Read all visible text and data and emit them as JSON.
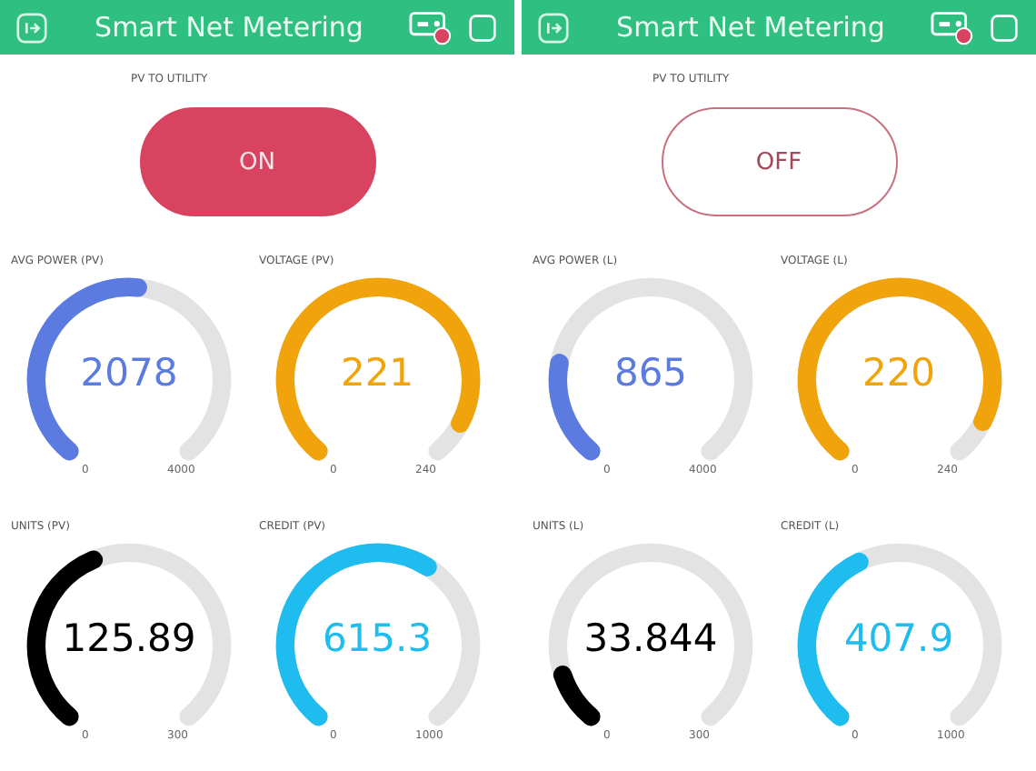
{
  "screens": [
    {
      "title": "Smart Net Metering",
      "toggle": {
        "label": "PV TO UTILITY",
        "text": "ON",
        "on": true
      },
      "gauges": [
        {
          "label": "AVG POWER (PV)",
          "value": "2078",
          "min": "0",
          "max": "4000",
          "color": "#5b7be0"
        },
        {
          "label": "VOLTAGE (PV)",
          "value": "221",
          "min": "0",
          "max": "240",
          "color": "#f0a30a"
        },
        {
          "label": "UNITS (PV)",
          "value": "125.89",
          "min": "0",
          "max": "300",
          "color": "#000000"
        },
        {
          "label": "CREDIT (PV)",
          "value": "615.3",
          "min": "0",
          "max": "1000",
          "color": "#1fbcef"
        }
      ]
    },
    {
      "title": "Smart Net Metering",
      "toggle": {
        "label": "PV TO UTILITY",
        "text": "OFF",
        "on": false
      },
      "gauges": [
        {
          "label": "AVG POWER (L)",
          "value": "865",
          "min": "0",
          "max": "4000",
          "color": "#5b7be0"
        },
        {
          "label": "VOLTAGE (L)",
          "value": "220",
          "min": "0",
          "max": "240",
          "color": "#f0a30a"
        },
        {
          "label": "UNITS (L)",
          "value": "33.844",
          "min": "0",
          "max": "300",
          "color": "#000000"
        },
        {
          "label": "CREDIT (L)",
          "value": "407.9",
          "min": "0",
          "max": "1000",
          "color": "#1fbcef"
        }
      ]
    }
  ]
}
